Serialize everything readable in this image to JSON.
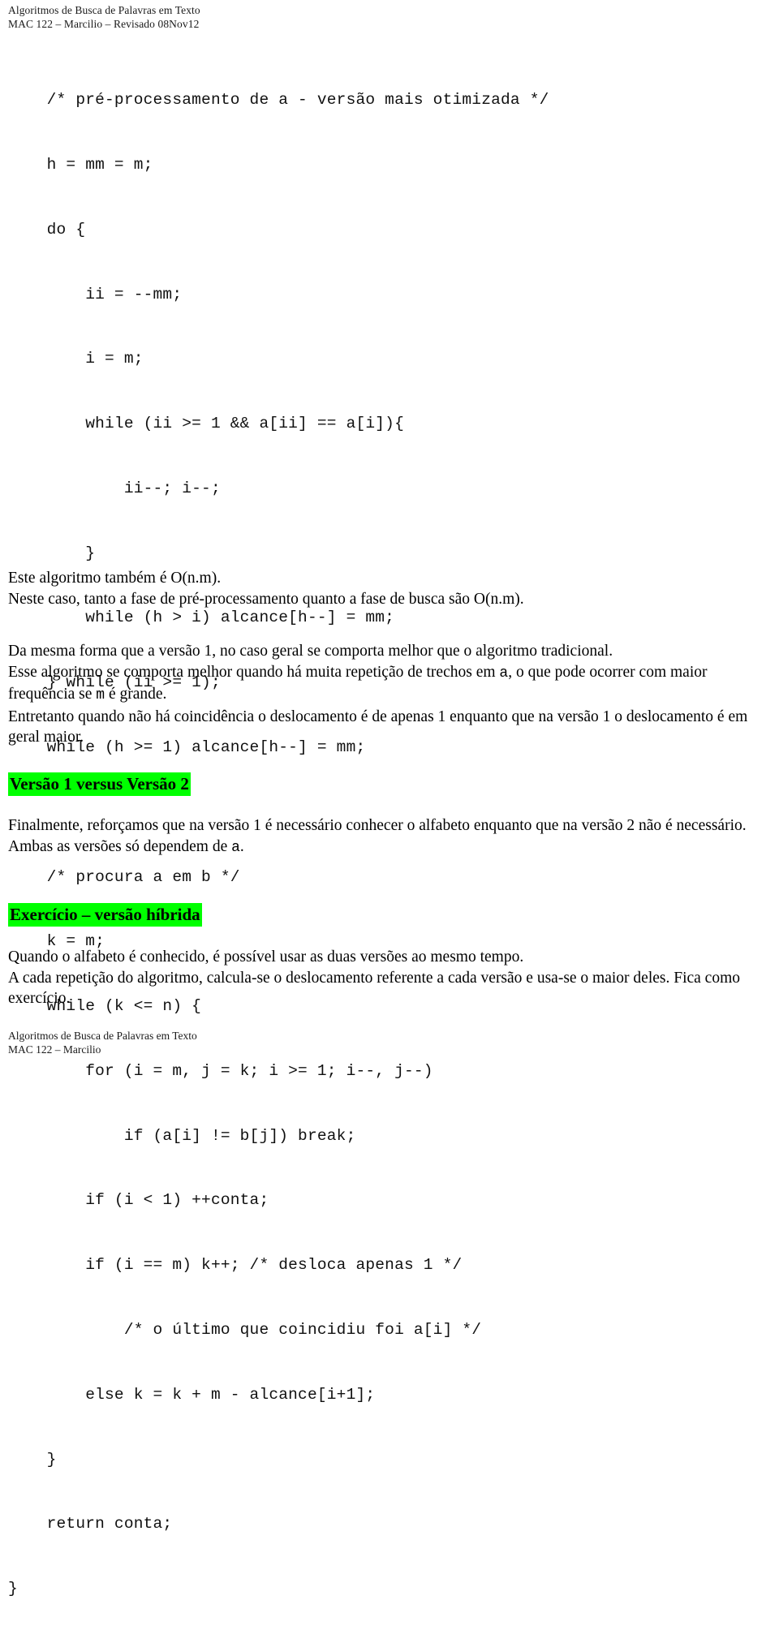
{
  "header": {
    "line1": "Algoritmos de Busca de Palavras em Texto",
    "line2": "MAC 122 – Marcilio – Revisado 08Nov12"
  },
  "code": {
    "language": "c",
    "lines": [
      "    /* pré-processamento de a - versão mais otimizada */",
      "    h = mm = m;",
      "    do {",
      "        ii = --mm;",
      "        i = m;",
      "        while (ii >= 1 && a[ii] == a[i]){",
      "            ii--; i--;",
      "        }",
      "        while (h > i) alcance[h--] = mm;",
      "    } while (ii >= 1);",
      "    while (h >= 1) alcance[h--] = mm;",
      "",
      "    /* procura a em b */",
      "    k = m;",
      "    while (k <= n) {",
      "        for (i = m, j = k; i >= 1; i--, j--)",
      "            if (a[i] != b[j]) break;",
      "        if (i < 1) ++conta;",
      "        if (i == m) k++; /* desloca apenas 1 */",
      "            /* o último que coincidiu foi a[i] */",
      "        else k = k + m - alcance[i+1];",
      "    }",
      "    return conta;",
      "}"
    ]
  },
  "body": {
    "para1": {
      "line1": "Este algoritmo também é O(n.m).",
      "line2": "Neste caso, tanto a fase de pré-processamento quanto a fase de busca são O(n.m)."
    },
    "para2": {
      "line1": "Da mesma forma que a versão 1, no caso geral se comporta melhor que o algoritmo tradicional.",
      "line2_a": "Esse algoritmo se comporta melhor quando há muita repetição de trechos em ",
      "line2_mono": "a",
      "line2_b": ", o que pode ocorrer com maior frequência se ",
      "line2_mono2": "m",
      "line2_c": " é grande.",
      "line3": "Entretanto quando não há coincidência o deslocamento é de apenas 1 enquanto que na versão 1 o deslocamento é em geral maior."
    },
    "heading1": "Versão 1 versus Versão 2",
    "para3": {
      "line1": "Finalmente, reforçamos que na versão 1 é necessário conhecer o alfabeto enquanto que na versão 2 não é necessário.",
      "line2_a": "Ambas as versões só dependem de ",
      "line2_mono": "a",
      "line2_b": "."
    },
    "heading2": "Exercício – versão híbrida",
    "para4": {
      "line1": "Quando o alfabeto é conhecido, é possível usar as duas versões ao mesmo tempo.",
      "line2": "A cada repetição do algoritmo, calcula-se o deslocamento referente a cada versão e usa-se o maior deles. Fica como exercício."
    }
  },
  "footer": {
    "line1": "Algoritmos de Busca de Palavras em Texto",
    "line2": "MAC 122 – Marcilio"
  },
  "colors": {
    "highlight": "#00ff00",
    "text": "#000000",
    "page": "#ffffff"
  }
}
